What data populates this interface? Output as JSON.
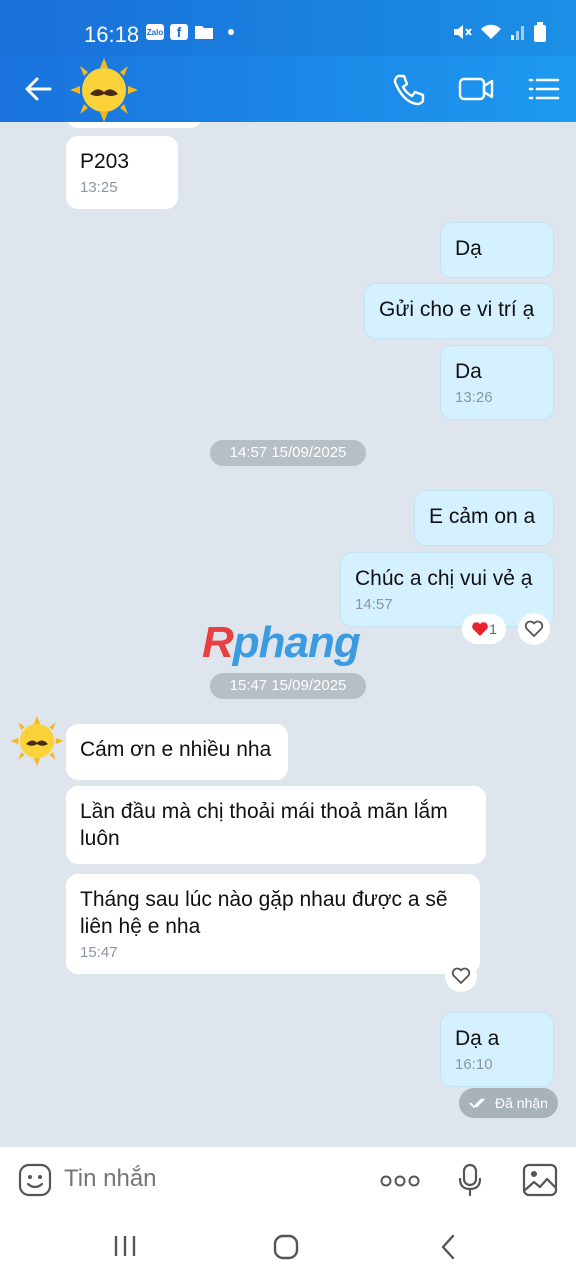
{
  "status_bar": {
    "time": "16:18",
    "app_badge": "Zalo"
  },
  "header": {
    "back_icon": "arrow-left-icon",
    "avatar_icon": "sun-mustache-avatar",
    "actions": [
      "phone-icon",
      "video-icon",
      "menu-list-icon"
    ]
  },
  "messages": [
    {
      "side": "in",
      "text": "P203",
      "time": "13:25"
    },
    {
      "side": "out",
      "text": "Dạ",
      "time": ""
    },
    {
      "side": "out",
      "text": "Gửi cho e vi trí ạ",
      "time": ""
    },
    {
      "side": "out",
      "text": "Da",
      "time": "13:26"
    },
    {
      "side": "out",
      "text": "E cảm on a",
      "time": ""
    },
    {
      "side": "out",
      "text": "Chúc a chị vui vẻ ạ",
      "time": "14:57"
    },
    {
      "side": "in",
      "text": "Cám ơn e nhiều nha",
      "time": ""
    },
    {
      "side": "in",
      "text": "Lần đầu mà chị thoải mái thoả mãn lắm luôn",
      "time": ""
    },
    {
      "side": "in",
      "text": "Tháng sau lúc nào gặp nhau được a sẽ liên hệ e nha",
      "time": "15:47"
    },
    {
      "side": "out",
      "text": "Dạ a",
      "time": "16:10"
    }
  ],
  "date_separators": [
    "14:57 15/09/2025",
    "15:47 15/09/2025"
  ],
  "reaction": {
    "count": "1",
    "emoji": "heart"
  },
  "delivery_status": "Đã nhận",
  "watermark": {
    "first": "R",
    "rest": "phang"
  },
  "composer": {
    "placeholder": "Tin nhắn"
  },
  "colors": {
    "header": "#1a72dc",
    "outgoing": "#d5f1ff",
    "incoming": "#ffffff",
    "background": "#dfe5ec"
  }
}
